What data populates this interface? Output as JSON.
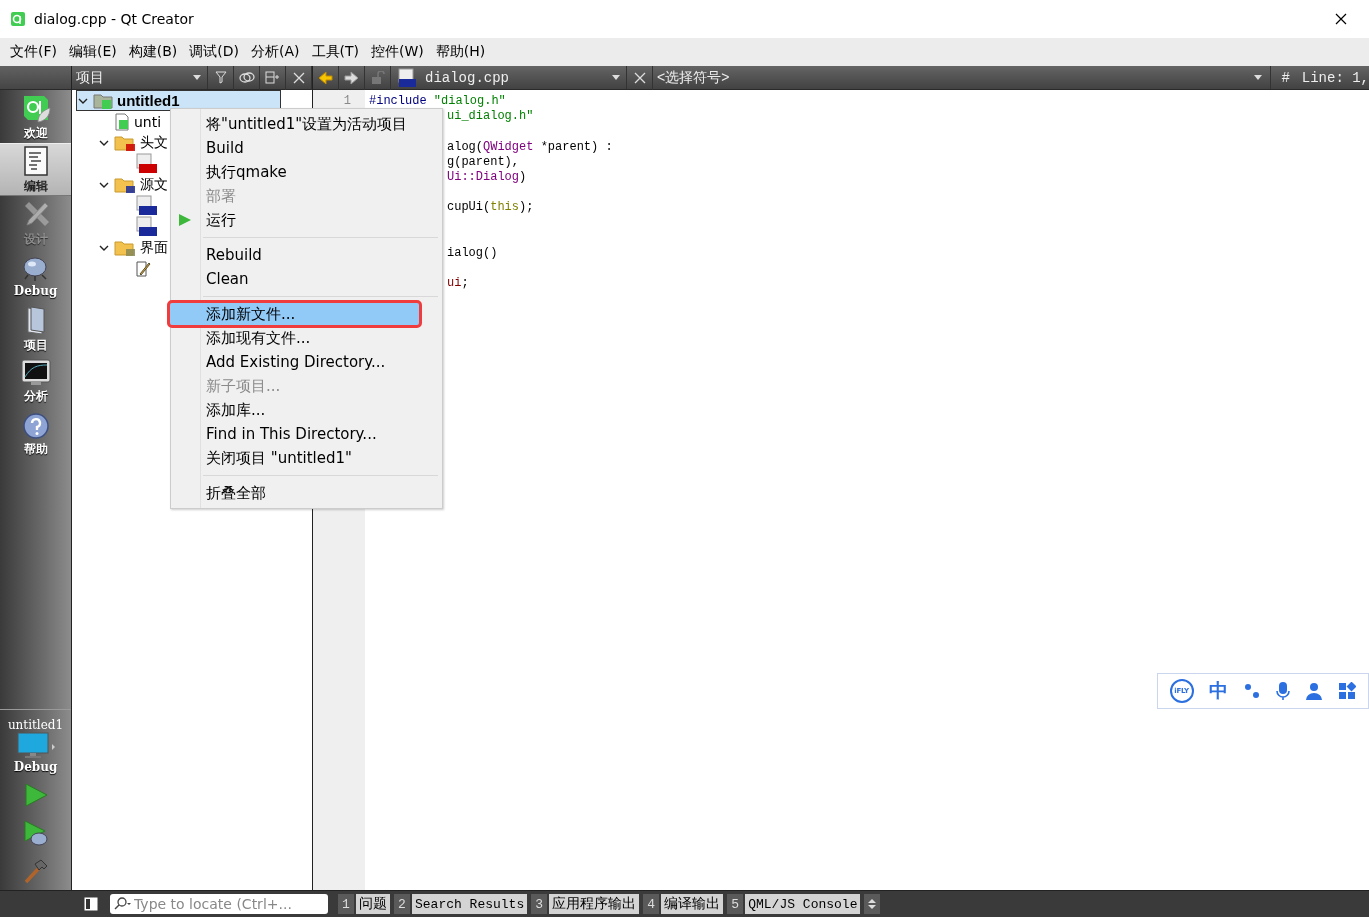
{
  "window": {
    "title": "dialog.cpp - Qt Creator"
  },
  "menu_bar": [
    "文件(F)",
    "编辑(E)",
    "构建(B)",
    "调试(D)",
    "分析(A)",
    "工具(T)",
    "控件(W)",
    "帮助(H)"
  ],
  "mode_bar": {
    "modes": [
      {
        "label": "欢迎",
        "kind": "welcome",
        "selected": false,
        "disabled": false
      },
      {
        "label": "编辑",
        "kind": "edit",
        "selected": true,
        "disabled": false
      },
      {
        "label": "设计",
        "kind": "design",
        "selected": false,
        "disabled": true
      },
      {
        "label": "Debug",
        "kind": "debug",
        "selected": false,
        "disabled": false
      },
      {
        "label": "项目",
        "kind": "projects",
        "selected": false,
        "disabled": false
      },
      {
        "label": "分析",
        "kind": "analyze",
        "selected": false,
        "disabled": false
      },
      {
        "label": "帮助",
        "kind": "help",
        "selected": false,
        "disabled": false
      }
    ],
    "target": {
      "project": "untitled1",
      "config": "Debug"
    }
  },
  "project_panel": {
    "view": "项目",
    "tree": [
      {
        "label": "untitled1",
        "kind": "project",
        "selected": true,
        "expanded": true,
        "children": [
          {
            "label": "unti",
            "kind": "pro",
            "selected": false
          },
          {
            "label": "头文",
            "kind": "folder-h",
            "selected": false,
            "expanded": true,
            "children": [
              {
                "kind": "header",
                "selected": false
              }
            ]
          },
          {
            "label": "源文",
            "kind": "folder-src",
            "selected": false,
            "expanded": true,
            "children": [
              {
                "kind": "cpp",
                "selected": false
              },
              {
                "kind": "cpp",
                "selected": false
              }
            ]
          },
          {
            "label": "界面",
            "kind": "folder-ui",
            "selected": false,
            "expanded": true,
            "children": [
              {
                "kind": "ui",
                "selected": false
              }
            ]
          }
        ]
      }
    ]
  },
  "editor": {
    "file": "dialog.cpp",
    "symbol": "<选择符号>",
    "hash": "#",
    "position": "Line: 1,",
    "line_numbers": [
      "1"
    ],
    "lines": [
      {
        "kind": "code",
        "clipped": false,
        "tokens": [
          {
            "text": "#include",
            "kind": "preprocessor"
          },
          {
            "text": " \"dialog.h\"",
            "kind": "string"
          }
        ]
      },
      {
        "kind": "code",
        "clipped": true,
        "tokens": [
          {
            "text": "ui_dialog.h\"",
            "kind": "string"
          }
        ]
      },
      {
        "kind": "blank"
      },
      {
        "kind": "code",
        "clipped": true,
        "tokens": [
          {
            "text": "alog(",
            "kind": "plain"
          },
          {
            "text": "QWidget",
            "kind": "type"
          },
          {
            "text": " *parent) :",
            "kind": "plain"
          }
        ]
      },
      {
        "kind": "code",
        "clipped": true,
        "tokens": [
          {
            "text": "g(parent),",
            "kind": "plain"
          }
        ]
      },
      {
        "kind": "code",
        "clipped": true,
        "tokens": [
          {
            "text": "Ui::Dialog",
            "kind": "type"
          },
          {
            "text": ")",
            "kind": "plain"
          }
        ]
      },
      {
        "kind": "blank"
      },
      {
        "kind": "code",
        "clipped": true,
        "tokens": [
          {
            "text": "cupUi(",
            "kind": "plain"
          },
          {
            "text": "this",
            "kind": "keyword"
          },
          {
            "text": ");",
            "kind": "plain"
          }
        ]
      },
      {
        "kind": "blank"
      },
      {
        "kind": "blank"
      },
      {
        "kind": "code",
        "clipped": true,
        "tokens": [
          {
            "text": "ialog()",
            "kind": "plain"
          }
        ]
      },
      {
        "kind": "blank"
      },
      {
        "kind": "code",
        "clipped": true,
        "tokens": [
          {
            "text": "ui",
            "kind": "member"
          },
          {
            "text": ";",
            "kind": "plain"
          }
        ]
      }
    ]
  },
  "context_menu": {
    "items": [
      {
        "kind": "item",
        "label": "将\"untitled1\"设置为活动项目",
        "disabled": false,
        "selected": false,
        "outlined": false
      },
      {
        "kind": "item",
        "label": "Build",
        "disabled": false,
        "selected": false,
        "outlined": false
      },
      {
        "kind": "item",
        "label": "执行qmake",
        "disabled": false,
        "selected": false,
        "outlined": false
      },
      {
        "kind": "item",
        "label": "部署",
        "disabled": true,
        "selected": false,
        "outlined": false
      },
      {
        "kind": "run",
        "label": "运行",
        "disabled": false,
        "selected": false,
        "outlined": false
      },
      {
        "kind": "separator"
      },
      {
        "kind": "item",
        "label": "Rebuild",
        "disabled": false,
        "selected": false,
        "outlined": false
      },
      {
        "kind": "item",
        "label": "Clean",
        "disabled": false,
        "selected": false,
        "outlined": false
      },
      {
        "kind": "separator"
      },
      {
        "kind": "item",
        "label": "添加新文件...",
        "disabled": false,
        "selected": true,
        "outlined": true
      },
      {
        "kind": "item",
        "label": "添加现有文件...",
        "disabled": false,
        "selected": false,
        "outlined": false
      },
      {
        "kind": "item",
        "label": "Add Existing Directory...",
        "disabled": false,
        "selected": false,
        "outlined": false
      },
      {
        "kind": "item",
        "label": "新子项目...",
        "disabled": true,
        "selected": false,
        "outlined": false
      },
      {
        "kind": "item",
        "label": "添加库...",
        "disabled": false,
        "selected": false,
        "outlined": false
      },
      {
        "kind": "item",
        "label": "Find in This Directory...",
        "disabled": false,
        "selected": false,
        "outlined": false
      },
      {
        "kind": "item",
        "label": "关闭项目 \"untitled1\"",
        "disabled": false,
        "selected": false,
        "outlined": false
      },
      {
        "kind": "separator"
      },
      {
        "kind": "item",
        "label": "折叠全部",
        "disabled": false,
        "selected": false,
        "outlined": false
      }
    ]
  },
  "ime_toolbar": {
    "logo": "iFLY",
    "mode": "中"
  },
  "output_bar": {
    "locator_placeholder": "Type to locate (Ctrl+...",
    "panes": [
      {
        "number": "1",
        "label": "问题"
      },
      {
        "number": "2",
        "label": "Search Results"
      },
      {
        "number": "3",
        "label": "应用程序输出"
      },
      {
        "number": "4",
        "label": "编译输出"
      },
      {
        "number": "5",
        "label": "QML/JS Console"
      }
    ]
  }
}
